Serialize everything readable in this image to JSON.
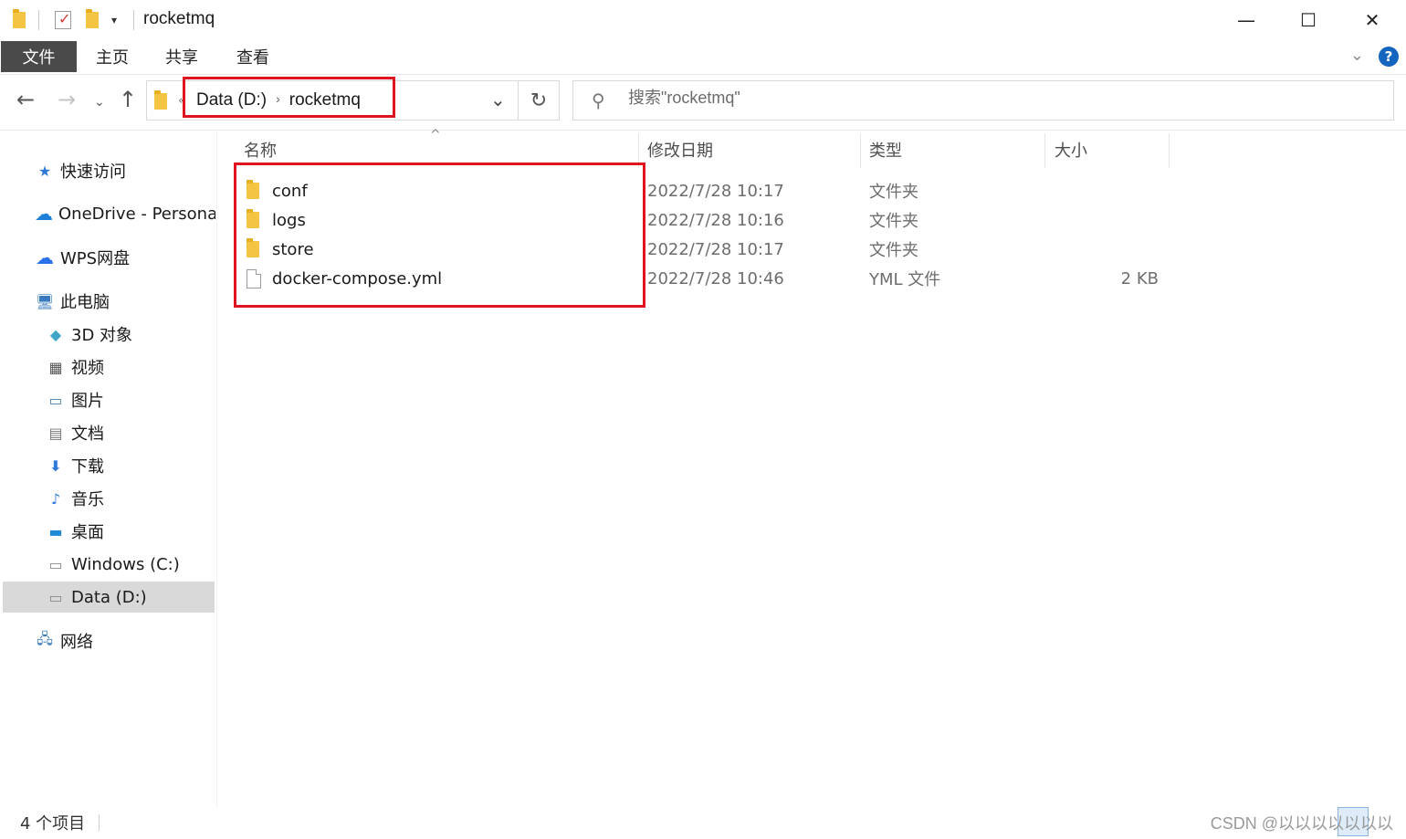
{
  "window": {
    "title": "rocketmq",
    "controls": {
      "minimize": "—",
      "maximize": "☐",
      "close": "✕"
    }
  },
  "ribbon": {
    "tabs": [
      "文件",
      "主页",
      "共享",
      "查看"
    ],
    "help": "?"
  },
  "address_bar": {
    "overflow": "«",
    "path": [
      "Data (D:)",
      "rocketmq"
    ],
    "separator": "›"
  },
  "search": {
    "placeholder": "搜索\"rocketmq\""
  },
  "sidebar": {
    "items": [
      {
        "label": "快速访问",
        "icon": "star-icon"
      },
      {
        "label": "OneDrive - Personal",
        "icon": "cloud-icon"
      },
      {
        "label": "WPS网盘",
        "icon": "wps-cloud-icon"
      },
      {
        "label": "此电脑",
        "icon": "computer-icon"
      },
      {
        "label": "3D 对象",
        "icon": "cube-icon"
      },
      {
        "label": "视频",
        "icon": "film-icon"
      },
      {
        "label": "图片",
        "icon": "picture-icon"
      },
      {
        "label": "文档",
        "icon": "document-icon"
      },
      {
        "label": "下载",
        "icon": "download-icon"
      },
      {
        "label": "音乐",
        "icon": "music-icon"
      },
      {
        "label": "桌面",
        "icon": "desktop-icon"
      },
      {
        "label": "Windows (C:)",
        "icon": "drive-icon"
      },
      {
        "label": "Data (D:)",
        "icon": "drive-icon",
        "selected": true
      },
      {
        "label": "网络",
        "icon": "network-icon"
      }
    ]
  },
  "columns": [
    "名称",
    "修改日期",
    "类型",
    "大小"
  ],
  "files": [
    {
      "name": "conf",
      "date": "2022/7/28 10:17",
      "type": "文件夹",
      "size": "",
      "kind": "folder"
    },
    {
      "name": "logs",
      "date": "2022/7/28 10:16",
      "type": "文件夹",
      "size": "",
      "kind": "folder"
    },
    {
      "name": "store",
      "date": "2022/7/28 10:17",
      "type": "文件夹",
      "size": "",
      "kind": "folder"
    },
    {
      "name": "docker-compose.yml",
      "date": "2022/7/28 10:46",
      "type": "YML 文件",
      "size": "2 KB",
      "kind": "file"
    }
  ],
  "status": {
    "count": "4 个项目"
  },
  "watermark": "CSDN @以以以以以以以",
  "colors": {
    "highlight": "#e0141e",
    "selected": "#d9d9d9",
    "file_tab": "#4a4a4a"
  }
}
